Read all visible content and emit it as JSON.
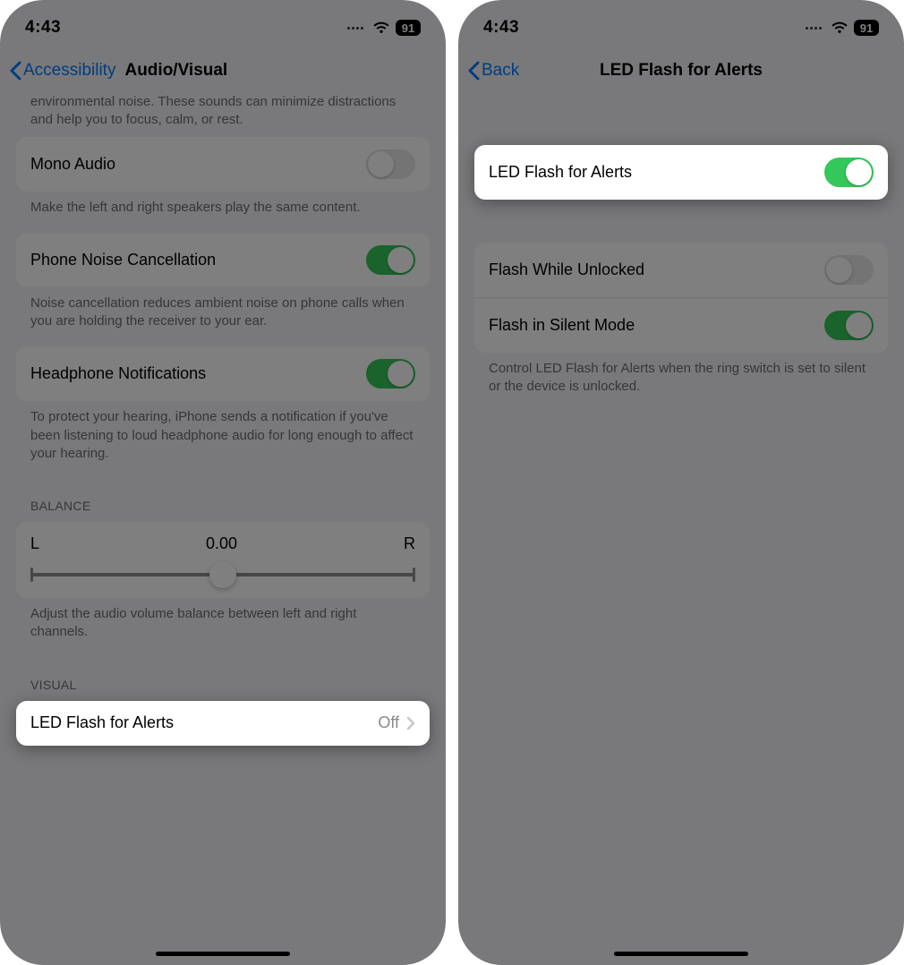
{
  "status": {
    "time": "4:43",
    "battery": "91"
  },
  "left": {
    "nav": {
      "back": "Accessibility",
      "title": "Audio/Visual"
    },
    "top_cut": "environmental noise. These sounds can minimize distractions and help you to focus, calm, or rest.",
    "mono_audio": {
      "label": "Mono Audio",
      "on": false,
      "desc": "Make the left and right speakers play the same content."
    },
    "noise_cancel": {
      "label": "Phone Noise Cancellation",
      "on": true,
      "desc": "Noise cancellation reduces ambient noise on phone calls when you are holding the receiver to your ear."
    },
    "headphone_notif": {
      "label": "Headphone Notifications",
      "on": true,
      "desc": "To protect your hearing, iPhone sends a notification if you've been listening to loud headphone audio for long enough to affect your hearing."
    },
    "balance": {
      "header": "BALANCE",
      "left": "L",
      "right": "R",
      "value": "0.00",
      "desc": "Adjust the audio volume balance between left and right channels."
    },
    "visual": {
      "header": "VISUAL",
      "led_label": "LED Flash for Alerts",
      "led_value": "Off"
    }
  },
  "right": {
    "nav": {
      "back": "Back",
      "title": "LED Flash for Alerts"
    },
    "led_main": {
      "label": "LED Flash for Alerts",
      "on": true
    },
    "unlocked": {
      "label": "Flash While Unlocked",
      "on": false
    },
    "silent": {
      "label": "Flash in Silent Mode",
      "on": true
    },
    "desc": "Control LED Flash for Alerts when the ring switch is set to silent or the device is unlocked."
  }
}
